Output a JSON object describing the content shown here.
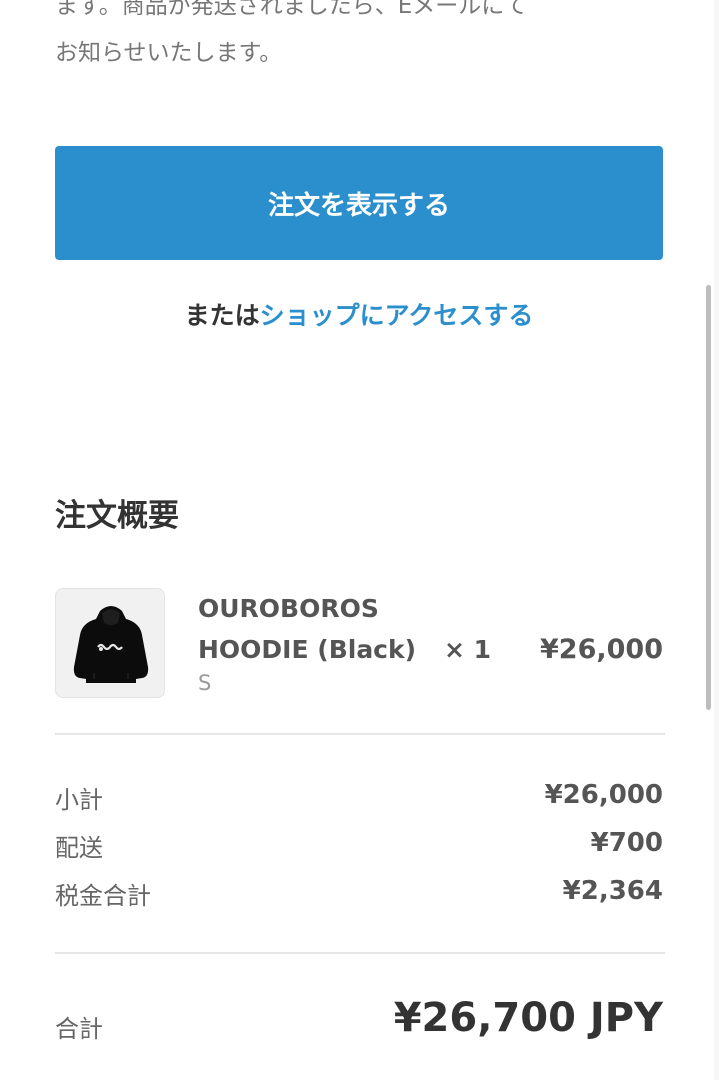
{
  "intro": {
    "line1": "ます。商品が発送されましたら、Eメールにて",
    "line2": "お知らせいたします。"
  },
  "actions": {
    "view_order_label": "注文を表示する",
    "alt_prefix": "または",
    "shop_link_label": "ショップにアクセスする"
  },
  "summary": {
    "title": "注文概要",
    "product": {
      "name_line1": "OUROBOROS",
      "name_line2": "HOODIE (Black)",
      "quantity": "× 1",
      "variant": "S",
      "price": "¥26,000",
      "image_icon": "hoodie-image"
    },
    "costs": [
      {
        "label": "小計",
        "value": "¥26,000"
      },
      {
        "label": "配送",
        "value": "¥700"
      },
      {
        "label": "税金合計",
        "value": "¥2,364"
      }
    ],
    "total": {
      "label": "合計",
      "value": "¥26,700 JPY"
    }
  },
  "colors": {
    "accent": "#2b8fcd",
    "text": "#333333",
    "muted": "#777777"
  }
}
